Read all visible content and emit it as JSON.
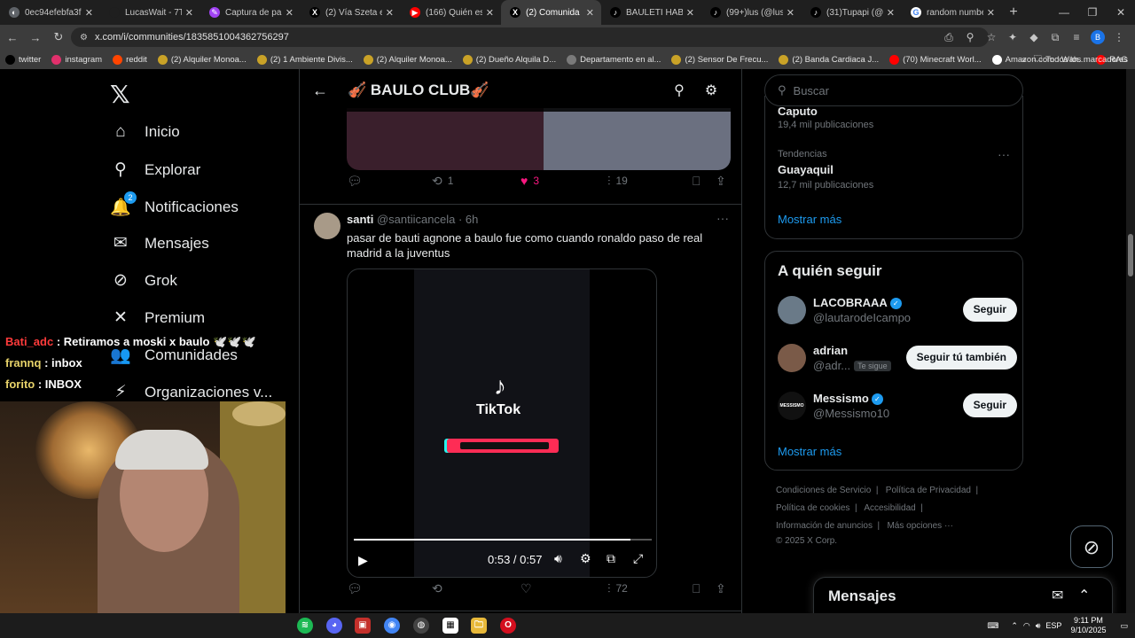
{
  "browser": {
    "tabs": [
      {
        "title": "0ec94efebfa3f725...",
        "color": "#5f6368",
        "glyph": "◐"
      },
      {
        "title": "LucasWait - 7TV",
        "color": "#1f1f1f",
        "glyph": ""
      },
      {
        "title": "Captura de panta...",
        "color": "#a142f4",
        "glyph": "✎"
      },
      {
        "title": "(2) Vía Szeta en X",
        "color": "#000000",
        "glyph": "X"
      },
      {
        "title": "(166) Quién es el ...",
        "color": "#ff0000",
        "glyph": "▶"
      },
      {
        "title": "(2) Comunida",
        "color": "#000000",
        "glyph": "X",
        "active": true
      },
      {
        "title": "BAULETI HABLA C...",
        "color": "#000000",
        "glyph": "♪"
      },
      {
        "title": "(99+)lus (@luslag...",
        "color": "#000000",
        "glyph": "♪"
      },
      {
        "title": "(31)Tupapi (@ieg...",
        "color": "#000000",
        "glyph": "♪"
      },
      {
        "title": "random number ...",
        "color": "#ffffff",
        "glyph": "G"
      }
    ],
    "url": "x.com/i/communities/1835851004362756297",
    "bookmarks": [
      {
        "label": "twitter",
        "color": "#000"
      },
      {
        "label": "instagram",
        "color": "#e1306c"
      },
      {
        "label": "reddit",
        "color": "#ff4500"
      },
      {
        "label": "(2) Alquiler Monoa...",
        "color": "#c9a227"
      },
      {
        "label": "(2) 1 Ambiente Divis...",
        "color": "#c9a227"
      },
      {
        "label": "(2) Alquiler Monoa...",
        "color": "#c9a227"
      },
      {
        "label": "(2) Dueño Alquila D...",
        "color": "#c9a227"
      },
      {
        "label": "Departamento en al...",
        "color": "#7a7a7a"
      },
      {
        "label": "(2) Sensor De Frecu...",
        "color": "#c9a227"
      },
      {
        "label": "(2) Banda Cardiaca J...",
        "color": "#c9a227"
      },
      {
        "label": "(70) Minecraft Worl...",
        "color": "#ff0000"
      },
      {
        "label": "Amazon.com : Wah...",
        "color": "#ffffff"
      },
      {
        "label": "RAG",
        "color": "#ff0000"
      }
    ],
    "all_bookmarks": "Todos los marcadores",
    "profile_initial": "B"
  },
  "sidebar": {
    "items": [
      {
        "label": "Inicio",
        "icon": "home-icon",
        "glyph": "⌂"
      },
      {
        "label": "Explorar",
        "icon": "search-icon",
        "glyph": "⚲"
      },
      {
        "label": "Notificaciones",
        "icon": "bell-icon",
        "glyph": "🔔",
        "badge": "2"
      },
      {
        "label": "Mensajes",
        "icon": "envelope-icon",
        "glyph": "✉"
      },
      {
        "label": "Grok",
        "icon": "grok-icon",
        "glyph": "⊘"
      },
      {
        "label": "Premium",
        "icon": "x-premium-icon",
        "glyph": "✕"
      },
      {
        "label": "Comunidades",
        "icon": "people-icon",
        "glyph": "👥"
      },
      {
        "label": "Organizaciones v...",
        "icon": "lightning-icon",
        "glyph": "⚡"
      }
    ]
  },
  "community": {
    "title": "🎻 BAULO CLUB🎻",
    "prev_tweet": {
      "retweets": "1",
      "likes": "3",
      "views": "19"
    },
    "tweet": {
      "name": "santi",
      "handle": "@santiicancela",
      "time": "6h",
      "text": "pasar de bauti agnone a baulo fue como cuando ronaldo paso de real madrid a la juventus",
      "views": "72",
      "video": {
        "brand": "TikTok",
        "time": "0:53 / 0:57",
        "progress": 0.93
      }
    }
  },
  "right": {
    "search_placeholder": "Buscar",
    "trends": [
      {
        "title": "Caputo",
        "count": "19,4 mil publicaciones"
      },
      {
        "context": "Tendencias",
        "title": "Guayaquil",
        "count": "12,7 mil publicaciones"
      }
    ],
    "show_more": "Mostrar más",
    "who_title": "A quién seguir",
    "who": [
      {
        "name": "LACOBRAAA",
        "handle": "@lautarodeIcampo",
        "verified": true,
        "button": "Seguir",
        "avatar_color": "#6a7a88"
      },
      {
        "name": "adrian",
        "handle": "@adr...",
        "follows_you": "Te sigue",
        "button": "Seguir tú también",
        "avatar_color": "#7a5a48"
      },
      {
        "name": "Messismo",
        "handle": "@Messismo10",
        "verified": true,
        "button": "Seguir",
        "avatar_color": "#111111",
        "avatar_text": "MESSISMO"
      }
    ],
    "who_more": "Mostrar más",
    "footer": {
      "line1": [
        "Condiciones de Servicio",
        "Política de Privacidad"
      ],
      "line2": [
        "Política de cookies",
        "Accesibilidad"
      ],
      "line3": [
        "Información de anuncios",
        "Más opciones ···"
      ],
      "copyright": "© 2025 X Corp."
    },
    "messages_title": "Mensajes"
  },
  "stream": {
    "chat": [
      {
        "user": "Bati_adc",
        "color": "#ff3b3b",
        "msg": "Retiramos a moski x baulo 🕊️🕊️🕊️"
      },
      {
        "user": "frannq",
        "color": "#e8d36a",
        "msg": "inbox"
      },
      {
        "user": "forito",
        "color": "#e8d36a",
        "msg": "INBOX"
      }
    ]
  },
  "taskbar": {
    "time": "9:11 PM",
    "date": "9/10/2025",
    "lang": "ESP"
  }
}
